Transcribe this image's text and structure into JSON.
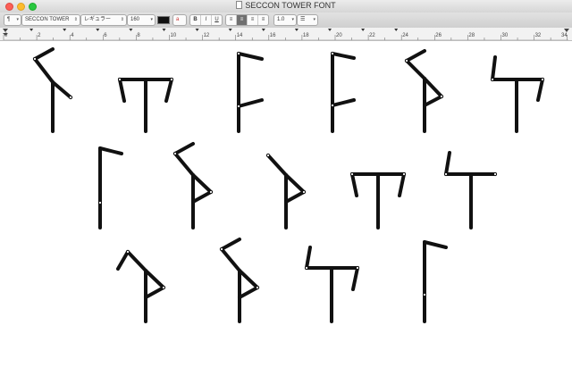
{
  "window": {
    "title": "SECCON TOWER FONT"
  },
  "toolbar": {
    "paragraph_style": "¶",
    "font_family": "SECCON TOWER",
    "font_style": "レギュラー",
    "font_size": "160",
    "text_color": "#111111",
    "bold": "B",
    "italic": "I",
    "underline": "U",
    "line_spacing": "1.0",
    "list_style": "☰"
  },
  "ruler": {
    "numbers": [
      "0",
      "2",
      "4",
      "6",
      "8",
      "10",
      "12",
      "14",
      "16",
      "18",
      "20",
      "22",
      "24",
      "26",
      "28",
      "30",
      "32",
      "34"
    ]
  },
  "document": {
    "glyphs": [
      {
        "name": "glyph-1"
      },
      {
        "name": "glyph-2"
      },
      {
        "name": "glyph-3"
      },
      {
        "name": "glyph-4"
      },
      {
        "name": "glyph-5"
      },
      {
        "name": "glyph-6"
      },
      {
        "name": "glyph-7"
      },
      {
        "name": "glyph-8"
      },
      {
        "name": "glyph-9"
      },
      {
        "name": "glyph-10"
      },
      {
        "name": "glyph-11"
      },
      {
        "name": "glyph-12"
      },
      {
        "name": "glyph-13"
      },
      {
        "name": "glyph-14"
      },
      {
        "name": "glyph-15"
      }
    ]
  }
}
